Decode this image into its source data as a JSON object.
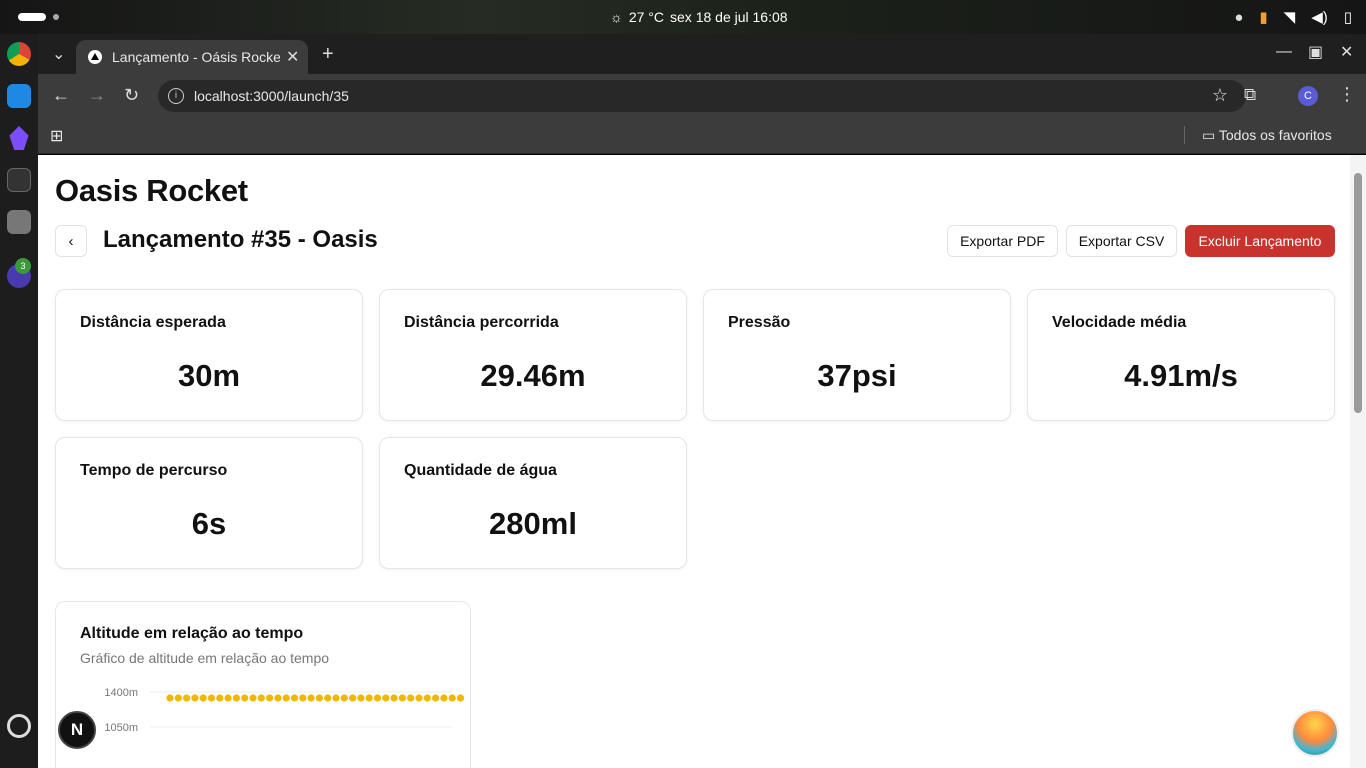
{
  "system": {
    "weather": "27 °C",
    "datetime": "sex 18 de jul  16:08"
  },
  "browser": {
    "tab_title": "Lançamento - Oásis Rocket",
    "url": "localhost:3000/launch/35",
    "bookmarks_label": "Todos os favoritos",
    "profile_initial": "C"
  },
  "page": {
    "app_title": "Oasis Rocket",
    "launch_title": "Lançamento #35 - Oasis",
    "buttons": {
      "export_pdf": "Exportar PDF",
      "export_csv": "Exportar CSV",
      "delete": "Excluir Lançamento"
    },
    "metrics": [
      {
        "label": "Distância esperada",
        "value": "30m"
      },
      {
        "label": "Distância percorrida",
        "value": "29.46m"
      },
      {
        "label": "Pressão",
        "value": "37psi"
      },
      {
        "label": "Velocidade média",
        "value": "4.91m/s"
      },
      {
        "label": "Tempo de percurso",
        "value": "6s"
      },
      {
        "label": "Quantidade de água",
        "value": "280ml"
      }
    ],
    "chart_title": "Altitude em relação ao tempo",
    "chart_subtitle": "Gráfico de altitude em relação ao tempo"
  },
  "dock": {
    "badge_count": "3"
  },
  "next_badge": "N",
  "colors": {
    "danger": "#c8332d",
    "series": "#f2b705"
  },
  "chart_data": {
    "type": "scatter",
    "title": "Altitude em relação ao tempo",
    "subtitle": "Gráfico de altitude em relação ao tempo",
    "y_ticks": [
      "1400m",
      "1050m"
    ],
    "series": [
      {
        "values": [
          1340,
          1340,
          1340,
          1340,
          1340,
          1340,
          1340,
          1340,
          1340,
          1340,
          1340,
          1340,
          1340,
          1340,
          1340,
          1340,
          1340,
          1340,
          1340,
          1340,
          1340,
          1340,
          1340,
          1340,
          1340,
          1340,
          1340,
          1340,
          1340,
          1340,
          1340,
          1340,
          1340,
          1340,
          1340,
          1340
        ]
      }
    ]
  }
}
